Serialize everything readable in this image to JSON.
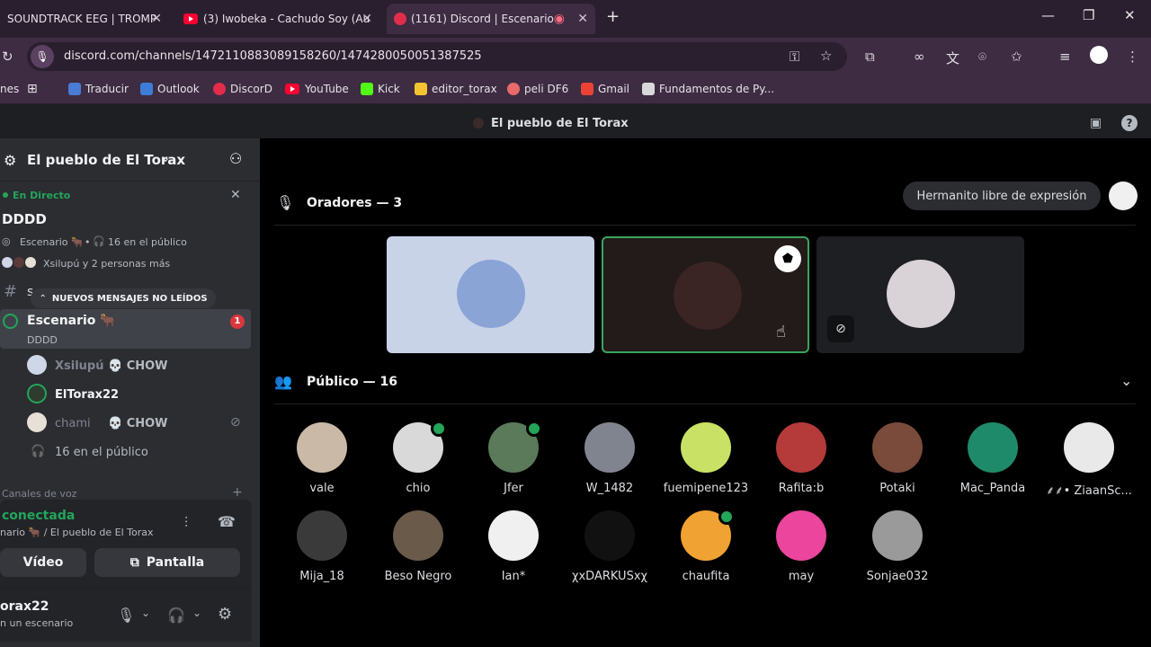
{
  "browser": {
    "tabs": [
      {
        "title": "SOUNDTRACK EEG | TROMP"
      },
      {
        "title": "(3) Iwobeka - Cachudo Soy (Au"
      },
      {
        "title": "(1161) Discord | Escenario"
      }
    ],
    "url": "discord.com/channels/1472110883089158260/1474280050051387525",
    "bookmarks": [
      {
        "label": "nes"
      },
      {
        "label": "Traducir"
      },
      {
        "label": "Outlook"
      },
      {
        "label": "DiscorD"
      },
      {
        "label": "YouTube"
      },
      {
        "label": "Kick"
      },
      {
        "label": "editor_torax"
      },
      {
        "label": "peli DF6"
      },
      {
        "label": "Gmail"
      },
      {
        "label": "Fundamentos de Py..."
      }
    ]
  },
  "window_title": "El pueblo de El Torax",
  "server": {
    "name": "El pueblo de El Torax",
    "live_label": "En Directo",
    "stage_title": "DDDD",
    "stage_info_channel": "Escenario 🐂",
    "stage_info_public": "16 en el público",
    "stage_participants": "Xsilupú y 2 personas más",
    "text_channel_partial": "s",
    "new_messages": "NUEVOS MENSAJES NO LEÍDOS",
    "channel_name": "Escenario 🐂",
    "channel_sub": "DDDD",
    "mention_count": "1",
    "members": [
      {
        "name": "Xsilupú",
        "tag": "💀 CHOW"
      },
      {
        "name": "ElTorax22",
        "tag": ""
      },
      {
        "name": "chami",
        "tag": "💀 CHOW"
      }
    ],
    "public_count": "16 en el público",
    "voice_section": "Canales de voz",
    "connected": "conectada",
    "connected_sub": "nario 🐂 / El pueblo de El Torax",
    "video_btn": "Vídeo",
    "screen_btn": "Pantalla",
    "user_name": "orax22",
    "user_status": "n un escenario"
  },
  "stage": {
    "speakers_label": "Oradores — 3",
    "hand_button": "Hermanito libre de expresión",
    "audience_label": "Público — 16",
    "audience": [
      {
        "name": "vale",
        "color": "#c9b9a6"
      },
      {
        "name": "chio",
        "color": "#d9d9d9"
      },
      {
        "name": "Jfer",
        "color": "#5a7a5a"
      },
      {
        "name": "W_1482",
        "color": "#80848e"
      },
      {
        "name": "fuemipene123",
        "color": "#c9e265"
      },
      {
        "name": "Rafita:b",
        "color": "#b53a3a"
      },
      {
        "name": "Potaki",
        "color": "#7a4a3a"
      },
      {
        "name": "Mac_Panda",
        "color": "#1f8a6a"
      },
      {
        "name": "⸙⸙• ZiaanSc...",
        "color": "#e9e9e9"
      },
      {
        "name": "Mija_18",
        "color": "#3a3a3a"
      },
      {
        "name": "Beso Negro",
        "color": "#6a5a4a"
      },
      {
        "name": "Ian*",
        "color": "#f0f0f0"
      },
      {
        "name": "χxDARKUSxχ",
        "color": "#111111"
      },
      {
        "name": "chaufita",
        "color": "#f0a232"
      },
      {
        "name": "may",
        "color": "#eb459e"
      },
      {
        "name": "Sonjae032",
        "color": "#9a9a9a"
      }
    ]
  },
  "colors": {
    "accent_green": "#23a55a",
    "speaker_highlight": "#3ba55d",
    "danger": "#da373c"
  }
}
